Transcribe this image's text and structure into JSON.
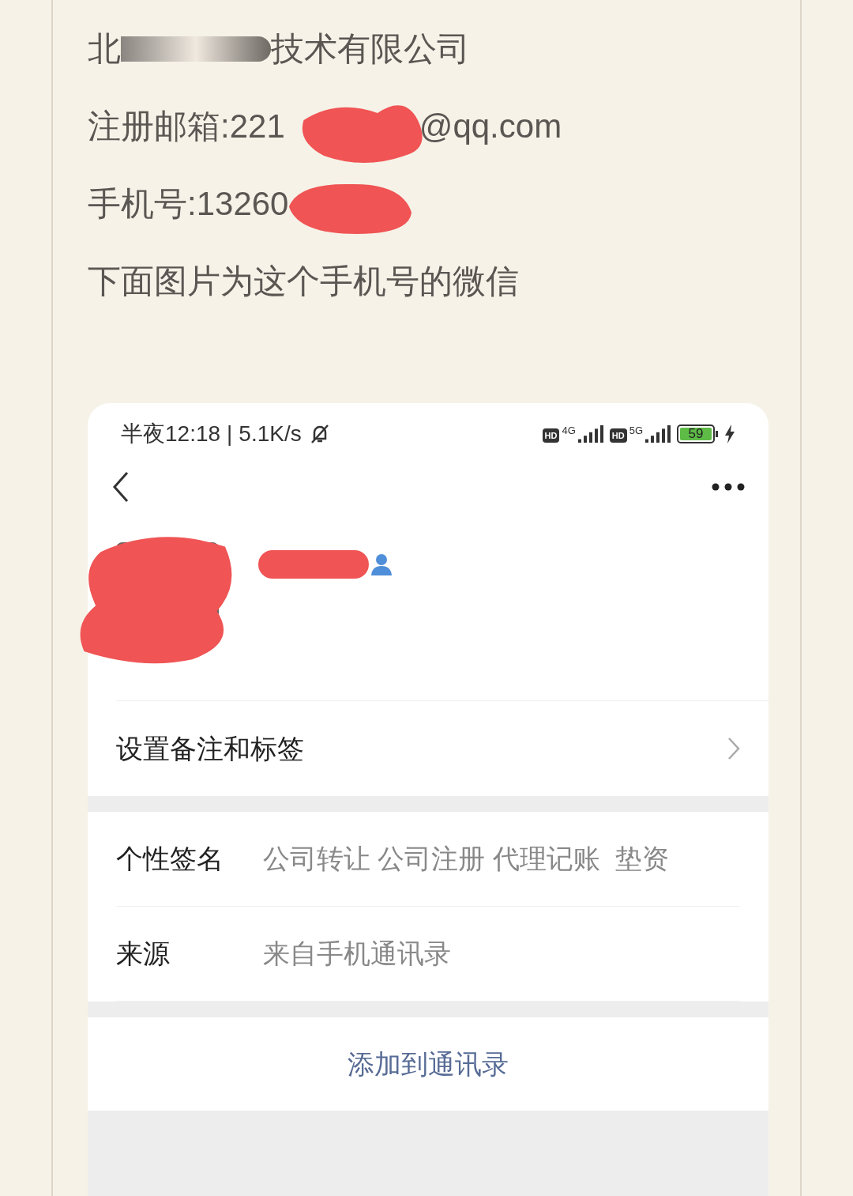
{
  "note": {
    "company_start": "北",
    "company_end": "技术有限公司",
    "email_label": "注册邮箱:221",
    "email_end": "@qq.com",
    "phone_label": "手机号:13260",
    "caption": "下面图片为这个手机号的微信"
  },
  "status_bar": {
    "time": "半夜12:18",
    "separator": "|",
    "speed": "5.1K/s",
    "battery": "59",
    "networks": [
      {
        "hd": "HD",
        "type": "4G"
      },
      {
        "hd": "HD",
        "type": "5G"
      }
    ]
  },
  "profile": {
    "rows": [
      {
        "kind": "link",
        "label": "设置备注和标签"
      },
      {
        "kind": "gap"
      },
      {
        "kind": "info",
        "label": "个性签名",
        "value": "公司转让 公司注册 代理记账  垫资"
      },
      {
        "kind": "info",
        "label": "来源",
        "value": "来自手机通讯录"
      },
      {
        "kind": "gap"
      },
      {
        "kind": "action",
        "label": "添加到通讯录"
      }
    ]
  }
}
